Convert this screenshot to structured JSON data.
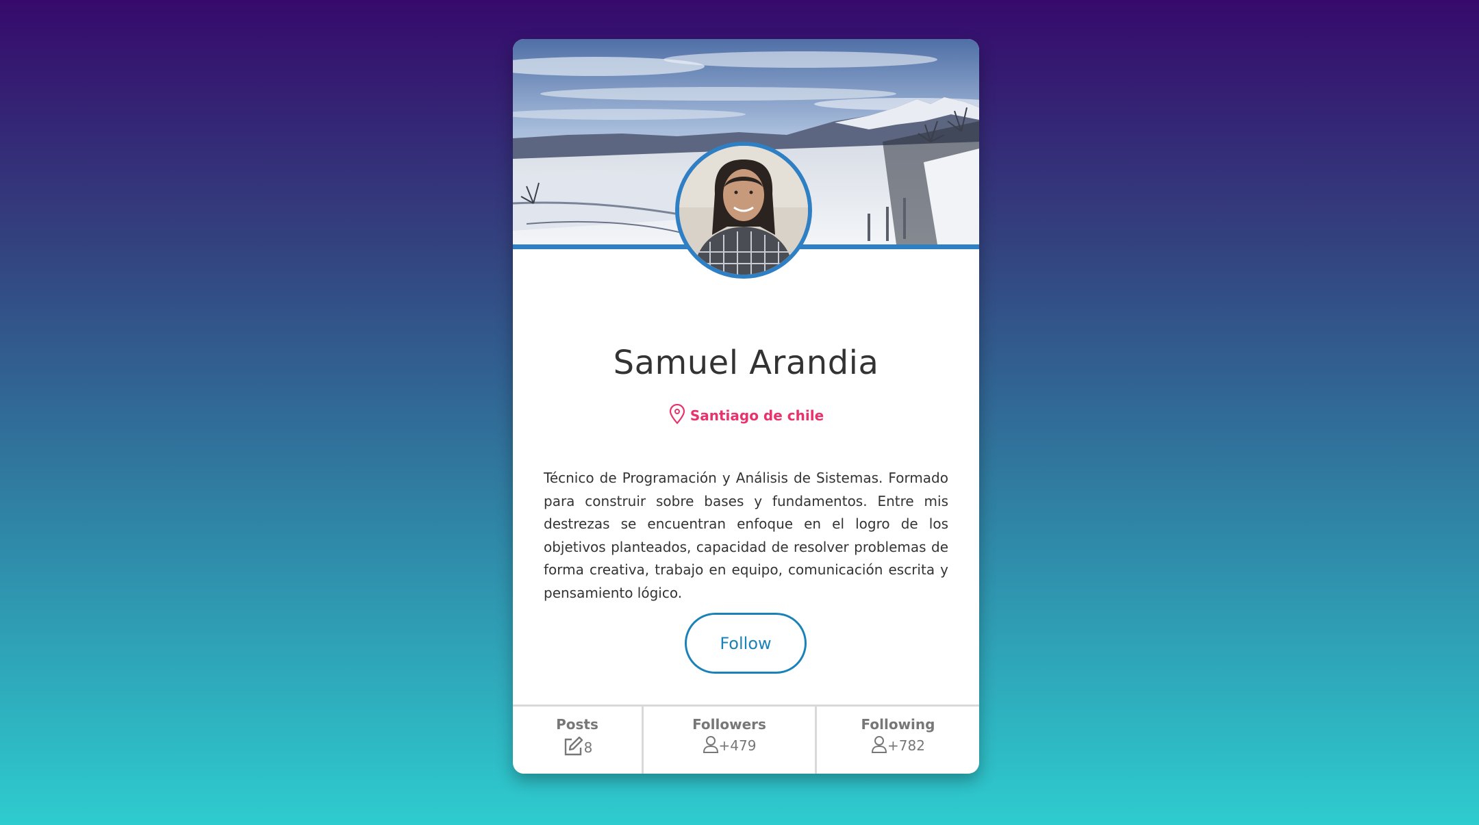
{
  "profile": {
    "name": "Samuel Arandia",
    "location": "Santiago de chile",
    "bio": "Técnico de Programación y Análisis de Sistemas. Formado para construir sobre bases y fundamentos. Entre mis destrezas se encuentran enfoque en el logro de los objetivos planteados, capacidad de resolver problemas de forma creativa, trabajo en equipo, comunicación escrita y pensamiento lógico.",
    "follow_label": "Follow"
  },
  "stats": {
    "posts": {
      "label": "Posts",
      "value": "8",
      "icon": "edit-icon"
    },
    "followers": {
      "label": "Followers",
      "value": "+479",
      "icon": "user-icon"
    },
    "following": {
      "label": "Following",
      "value": "+782",
      "icon": "user-icon"
    }
  },
  "icons": {
    "location": "map-pin-icon"
  },
  "colors": {
    "accent_blue": "#2f7fc4",
    "location_pink": "#e8336b",
    "button_blue": "#1a82b8",
    "stat_gray": "#777777"
  }
}
